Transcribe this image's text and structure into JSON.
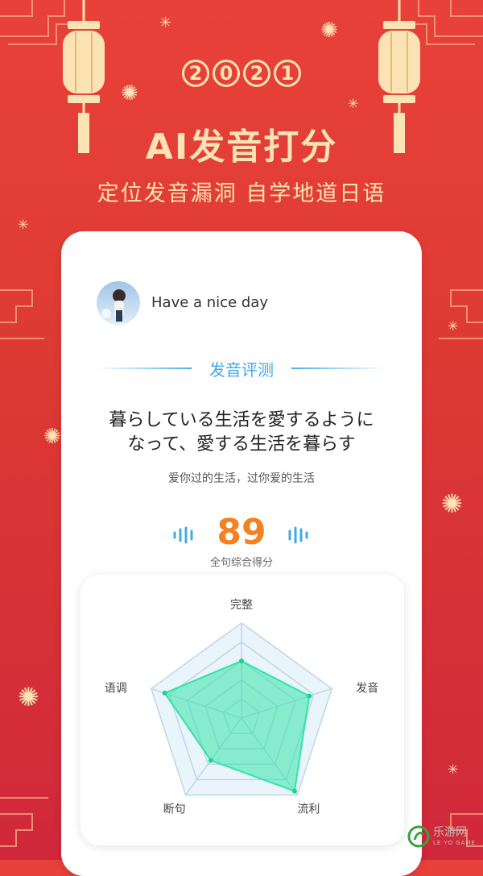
{
  "year": [
    "2",
    "0",
    "2",
    "1"
  ],
  "headline": "AI发音打分",
  "subline": "定位发音漏洞  自学地道日语",
  "card": {
    "username": "Have a nice day",
    "section_title": "发音评测",
    "sentence_line1": "暮らしている生活を愛するように",
    "sentence_line2": "なって、愛する生活を暮らす",
    "translation": "爱你过的生活，过你爱的生活",
    "score": "89",
    "score_label": "全句综合得分"
  },
  "radar": {
    "axes": [
      "完整",
      "发音",
      "流利",
      "断句",
      "语调"
    ],
    "values": [
      0.6,
      0.75,
      0.95,
      0.55,
      0.85
    ],
    "max": 1,
    "fill_color": "#34e3a9",
    "grid_color": "#bcd7ea"
  },
  "colors": {
    "background": "#e03c36",
    "gold": "#fbe3b4",
    "accent": "#40a9e6",
    "score": "#f58220"
  },
  "watermark": "乐游网",
  "watermark_sub": "LE YO GAME"
}
